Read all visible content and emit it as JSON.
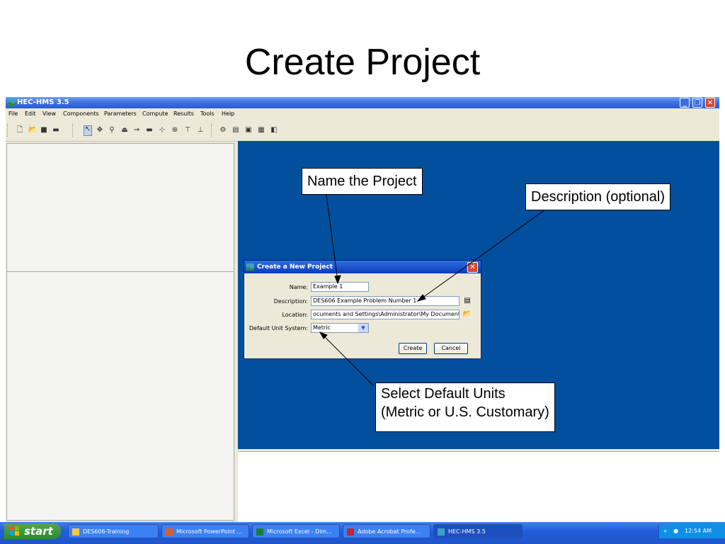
{
  "slide": {
    "title": "Create Project"
  },
  "window": {
    "title": "HEC-HMS 3.5",
    "menu": [
      "File",
      "Edit",
      "View",
      "Components",
      "Parameters",
      "Compute",
      "Results",
      "Tools",
      "Help"
    ],
    "toolbar_icons": [
      "new-icon",
      "open-icon",
      "save-icon",
      "print-icon",
      "arrow-icon",
      "move-icon",
      "zoom-icon",
      "subbasin-icon",
      "reach-icon",
      "reservoir-icon",
      "junction-icon",
      "diversion-icon",
      "source-icon",
      "sink-icon",
      "compute-icon",
      "results-icon",
      "graph-icon",
      "table-icon",
      "time-series-icon"
    ]
  },
  "dialog": {
    "title": "Create a New Project",
    "fields": {
      "name_label": "Name:",
      "name_value": "Example 1",
      "description_label": "Description:",
      "description_value": "DES606 Example Problem Number 1",
      "location_label": "Location:",
      "location_value": "ocuments and Settings\\Administrator\\My Documents",
      "unit_label": "Default Unit System:",
      "unit_value": "Metric"
    },
    "buttons": {
      "create": "Create",
      "cancel": "Cancel"
    }
  },
  "callouts": {
    "name": "Name the Project",
    "description": "Description (optional)",
    "units_line1": "Select Default Units",
    "units_line2": "(Metric or U.S. Customary)"
  },
  "taskbar": {
    "start": "start",
    "tasks": [
      "DES606-Training",
      "Microsoft PowerPoint ...",
      "Microsoft Excel - Dim...",
      "Adobe Acrobat Profe...",
      "HEC-HMS 3.5"
    ],
    "clock": "12:54 AM"
  },
  "colors": {
    "desktop": "#014f9d",
    "titlebar": "#2a5cd1",
    "taskbar": "#245edb",
    "start": "#2e8a2e"
  }
}
